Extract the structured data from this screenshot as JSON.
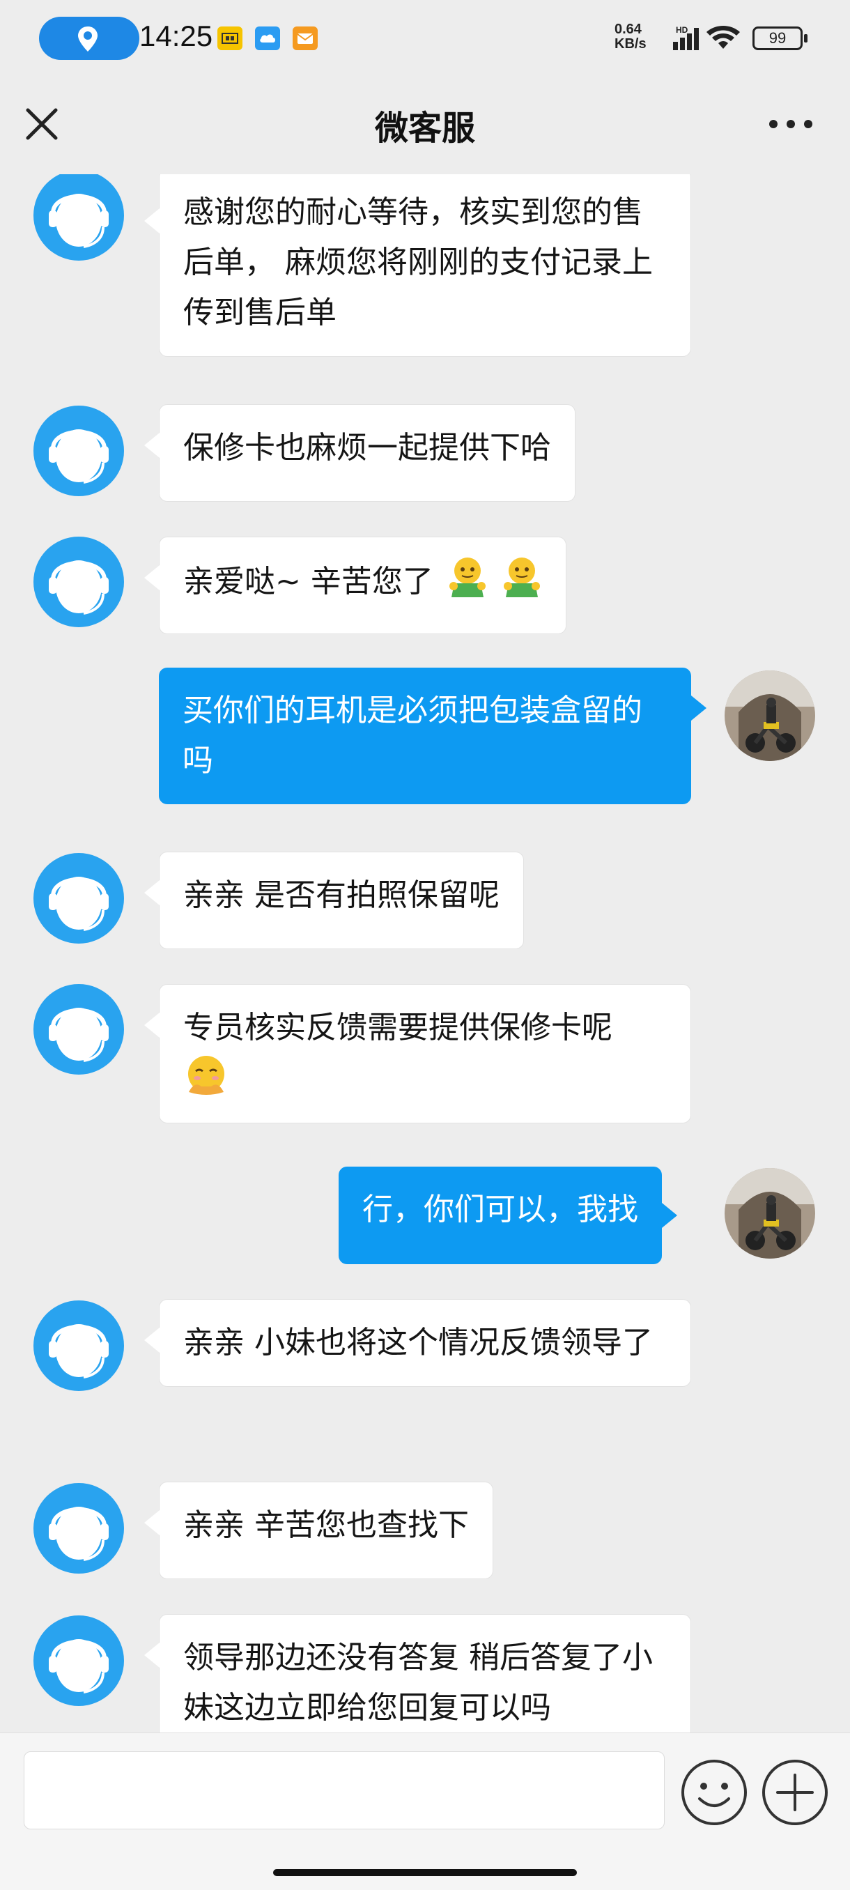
{
  "status_bar": {
    "time": "14:25",
    "net_speed_value": "0.64",
    "net_speed_unit": "KB/s",
    "network_badge": "HD",
    "battery": "99",
    "icons": [
      "location-icon",
      "sim-icon",
      "cloud-icon",
      "mail-icon",
      "signal-icon",
      "wifi-icon",
      "battery-icon"
    ]
  },
  "nav": {
    "title": "微客服",
    "left_icon": "close-icon",
    "right_icon": "more-icon"
  },
  "messages": [
    {
      "from": "agent",
      "text": "感谢您的耐心等待，核实到您的售后单， 麻烦您将刚刚的支付记录上传到售后单"
    },
    {
      "from": "agent",
      "text": "保修卡也麻烦一起提供下哈"
    },
    {
      "from": "agent",
      "text": "亲爱哒~ 辛苦您了",
      "emoji": "hug-emoji"
    },
    {
      "from": "user",
      "text": "买你们的耳机是必须把包装盒留的吗"
    },
    {
      "from": "agent",
      "text": "亲亲 是否有拍照保留呢"
    },
    {
      "from": "agent",
      "text": "专员核实反馈需要提供保修卡呢",
      "emoji": "sad-emoji"
    },
    {
      "from": "user",
      "text": "行，你们可以，我找"
    },
    {
      "from": "agent",
      "text": "亲亲 小妹也将这个情况反馈领导了"
    },
    {
      "from": "agent",
      "text": "亲亲 辛苦您也查找下"
    },
    {
      "from": "agent",
      "text": "领导那边还没有答复 稍后答复了小妹这边立即给您回复可以吗"
    }
  ],
  "input": {
    "placeholder": "",
    "emoji_button_icon": "smiley-icon",
    "plus_button_icon": "plus-icon"
  },
  "colors": {
    "user_bubble": "#0d9af2",
    "agent_bubble": "#ffffff",
    "background": "#ededed",
    "agent_avatar": "#29a3ef"
  }
}
